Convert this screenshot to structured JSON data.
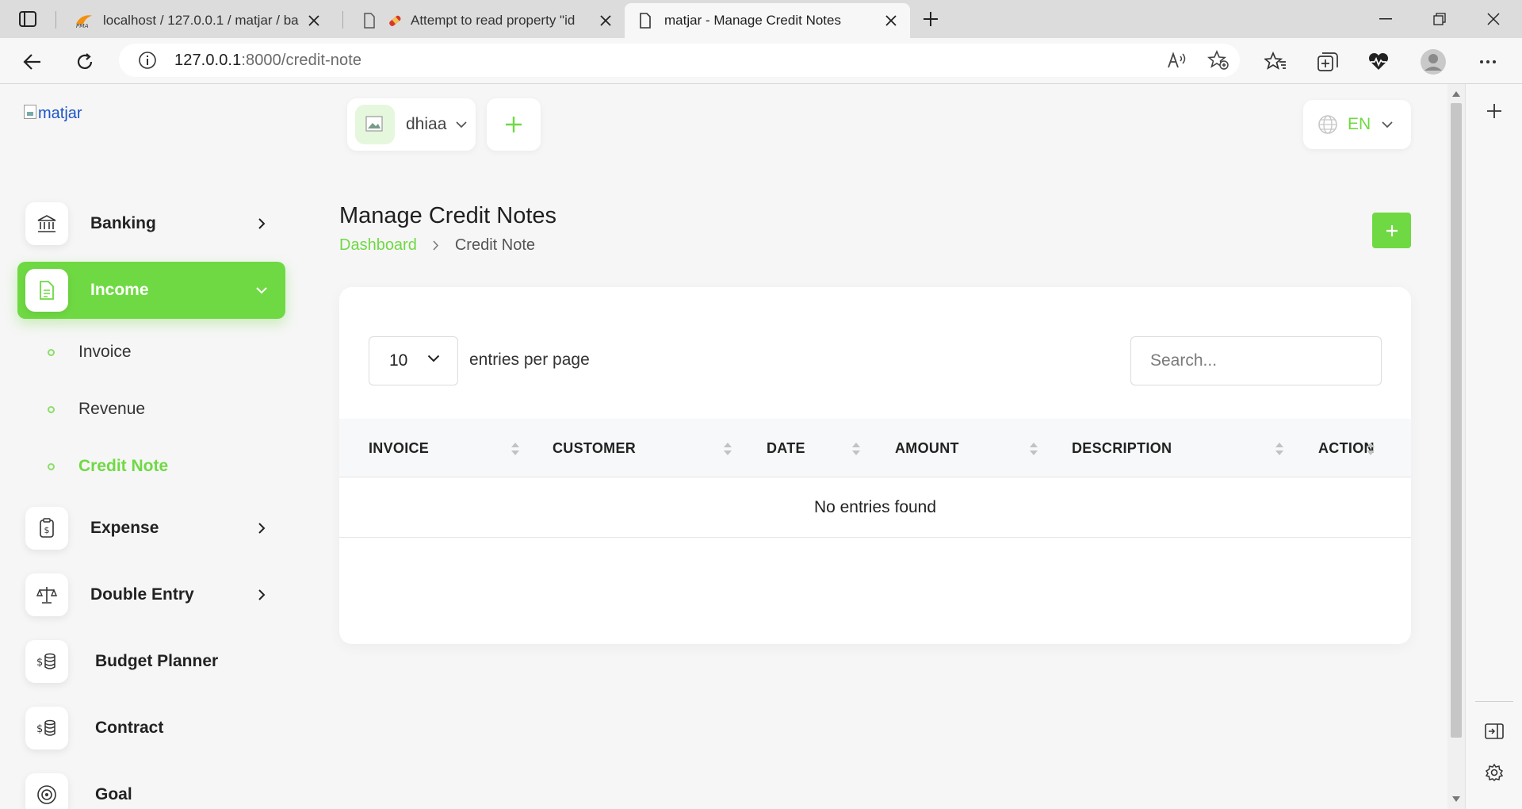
{
  "browser": {
    "tabs": [
      {
        "title": "localhost / 127.0.0.1 / matjar / ba",
        "active": false,
        "favicon": "phpmyadmin-icon"
      },
      {
        "title": "Attempt to read property \"id",
        "active": false,
        "favicon": "error-icon"
      },
      {
        "title": "matjar - Manage Credit Notes",
        "active": true,
        "favicon": "page-icon"
      }
    ],
    "url_host": "127.0.0.1",
    "url_rest": ":8000/credit-note"
  },
  "logo": {
    "alt": "matjar"
  },
  "header": {
    "user_name": "dhiaa",
    "language": "EN"
  },
  "sidebar": {
    "items": [
      {
        "label": "Banking",
        "icon": "bank-icon",
        "has_chevron": true
      },
      {
        "label": "Income",
        "icon": "document-icon",
        "active": true
      },
      {
        "label": "Expense",
        "icon": "receipt-icon",
        "has_chevron": true
      },
      {
        "label": "Double Entry",
        "icon": "scale-icon",
        "has_chevron": true
      },
      {
        "label": "Budget Planner",
        "icon": "coins-icon"
      },
      {
        "label": "Contract",
        "icon": "coins-icon"
      },
      {
        "label": "Goal",
        "icon": "target-icon"
      }
    ],
    "income_sub": [
      {
        "label": "Invoice"
      },
      {
        "label": "Revenue"
      },
      {
        "label": "Credit Note",
        "current": true
      }
    ]
  },
  "main": {
    "title": "Manage Credit Notes",
    "breadcrumb": [
      "Dashboard",
      "Credit Note"
    ],
    "table": {
      "per_page": "10",
      "per_page_label": "entries per page",
      "search_placeholder": "Search...",
      "columns": [
        "INVOICE",
        "CUSTOMER",
        "DATE",
        "AMOUNT",
        "DESCRIPTION",
        "ACTION"
      ],
      "rows": [],
      "empty_text": "No entries found"
    }
  },
  "colors": {
    "accent": "#6fd943",
    "tabstrip": "#dcdcdc",
    "page_bg": "#f6f6f6"
  }
}
